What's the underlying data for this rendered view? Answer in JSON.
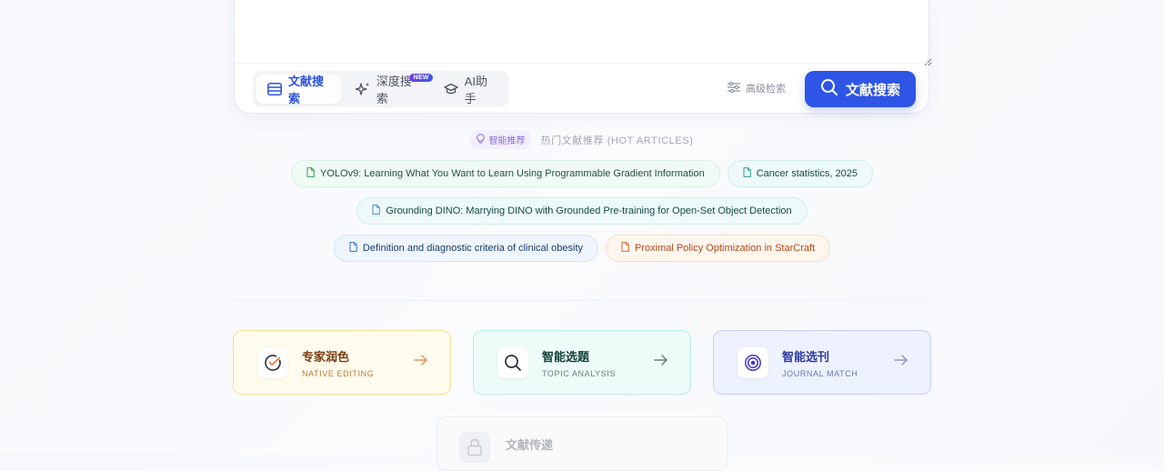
{
  "search": {
    "tabs": [
      {
        "label": "文献搜索",
        "icon": "list-icon",
        "active": true
      },
      {
        "label": "深度搜索",
        "icon": "sparkle-icon",
        "badge": "NEW"
      },
      {
        "label": "AI助手",
        "icon": "graduation-cap-icon"
      }
    ],
    "advanced_label": "高级检索",
    "submit_label": "文献搜索"
  },
  "hot": {
    "badge_label": "智能推荐",
    "title": "热门文献推荐 (HOT ARTICLES)",
    "articles": [
      {
        "title": "YOLOv9: Learning What You Want to Learn Using Programmable Gradient Information",
        "color": "green"
      },
      {
        "title": "Cancer statistics, 2025",
        "color": "teal"
      },
      {
        "title": "Grounding DINO: Marrying DINO with Grounded Pre-training for Open-Set Object Detection",
        "color": "teal"
      },
      {
        "title": "Definition and diagnostic criteria of clinical obesity",
        "color": "blue"
      },
      {
        "title": "Proximal Policy Optimization in StarCraft",
        "color": "orange"
      }
    ]
  },
  "features": [
    {
      "title": "专家润色",
      "subtitle": "NATIVE EDITING",
      "icon": "check-circle-icon",
      "accent": "#e8794a"
    },
    {
      "title": "智能选题",
      "subtitle": "TOPIC ANALYSIS",
      "icon": "search-icon",
      "accent": "#2a2f3a"
    },
    {
      "title": "智能选刊",
      "subtitle": "JOURNAL MATCH",
      "icon": "target-icon",
      "accent": "#4338ca"
    },
    {
      "title": "文献传递",
      "icon": "lock-icon",
      "disabled": true
    }
  ]
}
